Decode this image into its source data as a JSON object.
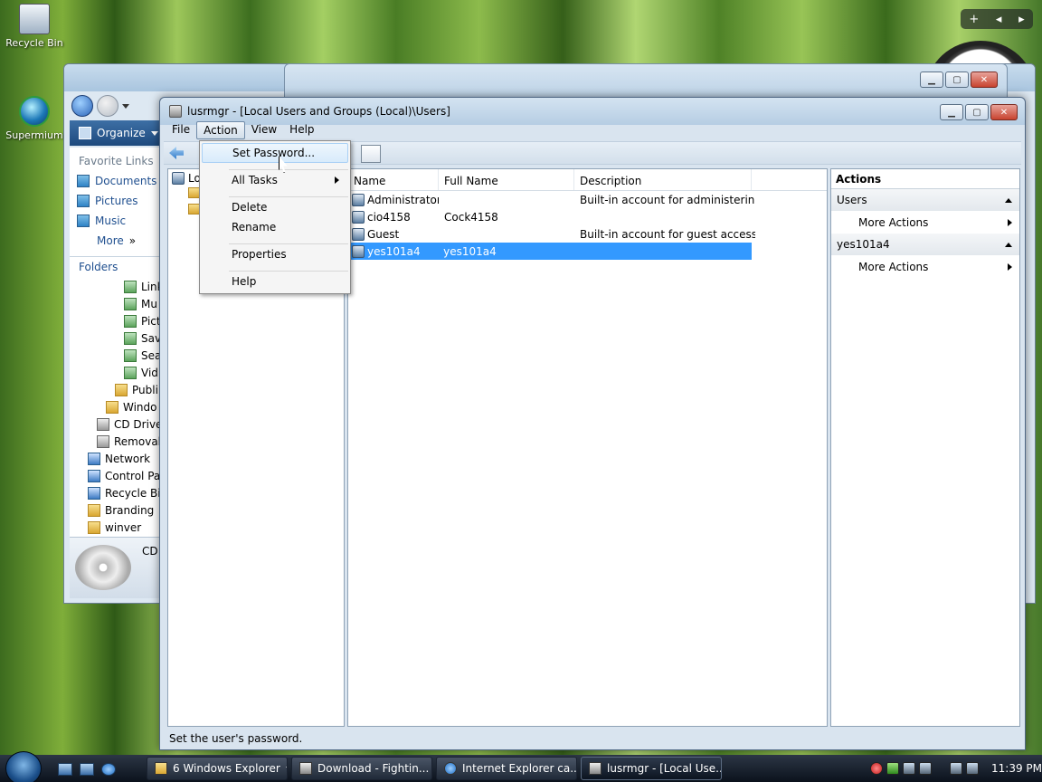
{
  "desktop": {
    "icons": [
      {
        "label": "Recycle Bin"
      },
      {
        "label": "Supermium"
      }
    ],
    "gadget_bar": {
      "add": "+",
      "prev": "◂",
      "next": "▸"
    }
  },
  "explorer": {
    "organize": "Organize",
    "favorite_links": "Favorite Links",
    "favorites": [
      "Documents",
      "Pictures",
      "Music",
      "More"
    ],
    "more_glyph": "»",
    "folders": "Folders",
    "tree": [
      {
        "label": "Link",
        "icon": "page",
        "indent": 3
      },
      {
        "label": "Mu",
        "icon": "page",
        "indent": 3
      },
      {
        "label": "Pict",
        "icon": "page",
        "indent": 3
      },
      {
        "label": "Sav",
        "icon": "page",
        "indent": 3
      },
      {
        "label": "Sea",
        "icon": "page",
        "indent": 3
      },
      {
        "label": "Vid",
        "icon": "page",
        "indent": 3
      },
      {
        "label": "Publi",
        "icon": "folder",
        "indent": 2
      },
      {
        "label": "Windo",
        "icon": "folder",
        "indent": 1
      },
      {
        "label": "CD Drive",
        "icon": "drive",
        "indent": 0
      },
      {
        "label": "Removab",
        "icon": "drive",
        "indent": 0
      },
      {
        "label": "Network",
        "icon": "net",
        "indent": -1
      },
      {
        "label": "Control Pa",
        "icon": "net",
        "indent": -1
      },
      {
        "label": "Recycle Bin",
        "icon": "net",
        "indent": -1
      },
      {
        "label": "Branding",
        "icon": "folder",
        "indent": -1
      },
      {
        "label": "winver",
        "icon": "folder",
        "indent": -1
      }
    ],
    "details_label": "CD"
  },
  "mmc": {
    "title": "lusrmgr - [Local Users and Groups (Local)\\Users]",
    "menus": [
      "File",
      "Action",
      "View",
      "Help"
    ],
    "tree_label": "Lo",
    "columns": [
      "Name",
      "Full Name",
      "Description"
    ],
    "rows": [
      {
        "name": "Administrator",
        "full_name": "",
        "description": "Built-in account for administering..."
      },
      {
        "name": "cio4158",
        "full_name": "Cock4158",
        "description": ""
      },
      {
        "name": "Guest",
        "full_name": "",
        "description": "Built-in account for guest access t..."
      },
      {
        "name": "yes101a4",
        "full_name": "yes101a4",
        "description": "",
        "selected": true
      }
    ],
    "actions": {
      "header": "Actions",
      "groups": [
        {
          "title": "Users",
          "item": "More Actions"
        },
        {
          "title": "yes101a4",
          "item": "More Actions"
        }
      ]
    },
    "status": "Set the user's password."
  },
  "action_menu": {
    "items": [
      "Set Password...",
      "All Tasks",
      "Delete",
      "Rename",
      "Properties",
      "Help"
    ]
  },
  "taskbar": {
    "buttons": [
      {
        "label": "6 Windows Explorer",
        "count": "6"
      },
      {
        "label": "Download - Fightin..."
      },
      {
        "label": "Internet Explorer ca..."
      },
      {
        "label": "lusrmgr - [Local Use..."
      }
    ],
    "clock": "11:39 PM"
  },
  "colors": {
    "selection": "#3399ff",
    "close_button": "#c8432f",
    "taskbar": "#0b121c"
  }
}
